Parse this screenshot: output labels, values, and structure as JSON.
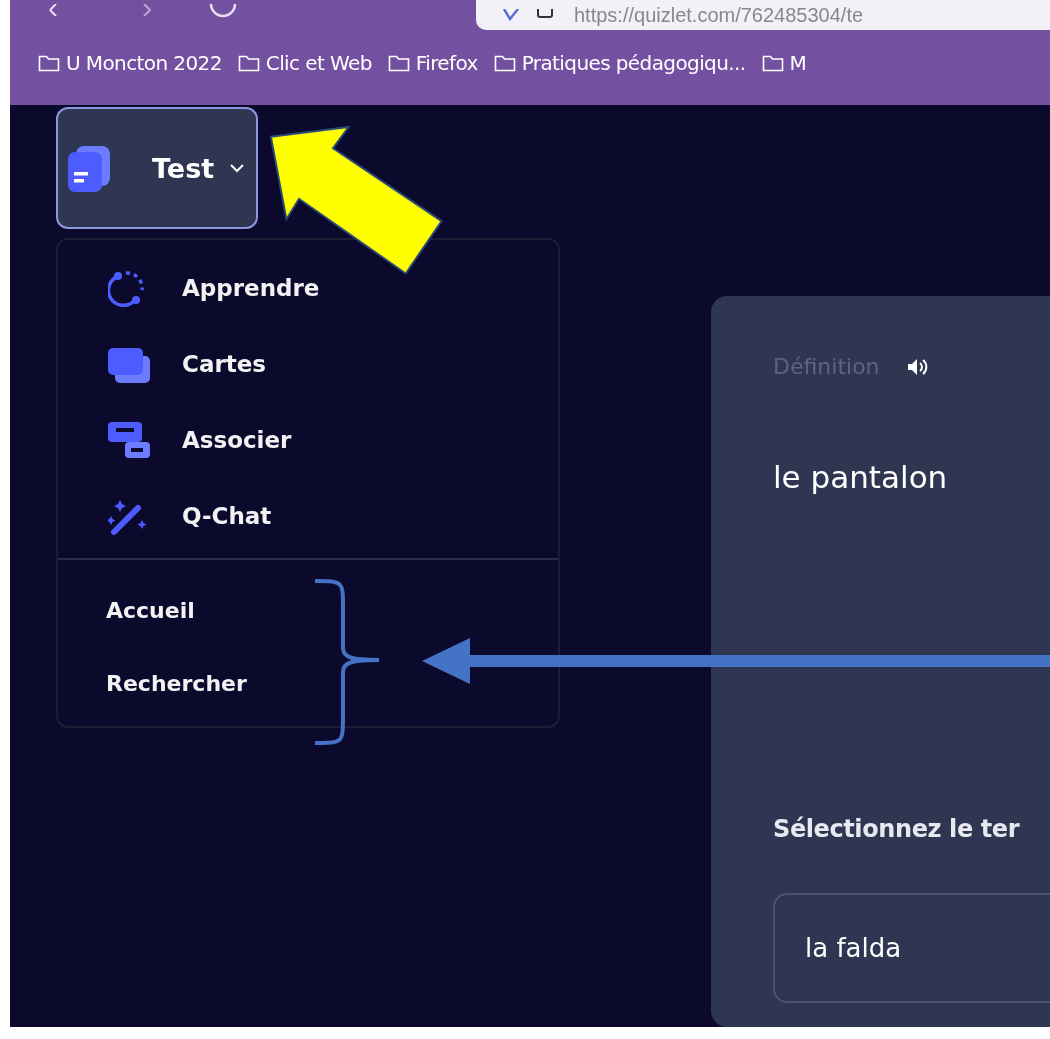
{
  "browser": {
    "url": "https://quizlet.com/762485304/te",
    "bookmarks": [
      "U Moncton 2022",
      "Clic et Web",
      "Firefox",
      "Pratiques pédagogiqu...",
      "M"
    ]
  },
  "set_menu": {
    "label": "Test",
    "expanded": true
  },
  "study_modes": [
    {
      "label": "Apprendre",
      "kind": "learn"
    },
    {
      "label": "Cartes",
      "kind": "cards"
    },
    {
      "label": "Associer",
      "kind": "match"
    },
    {
      "label": "Q-Chat",
      "kind": "chat"
    }
  ],
  "links": [
    "Accueil",
    "Rechercher"
  ],
  "card": {
    "side_label": "Définition",
    "term": "le pantalon",
    "prompt": "Sélectionnez le ter",
    "option": "la falda"
  }
}
